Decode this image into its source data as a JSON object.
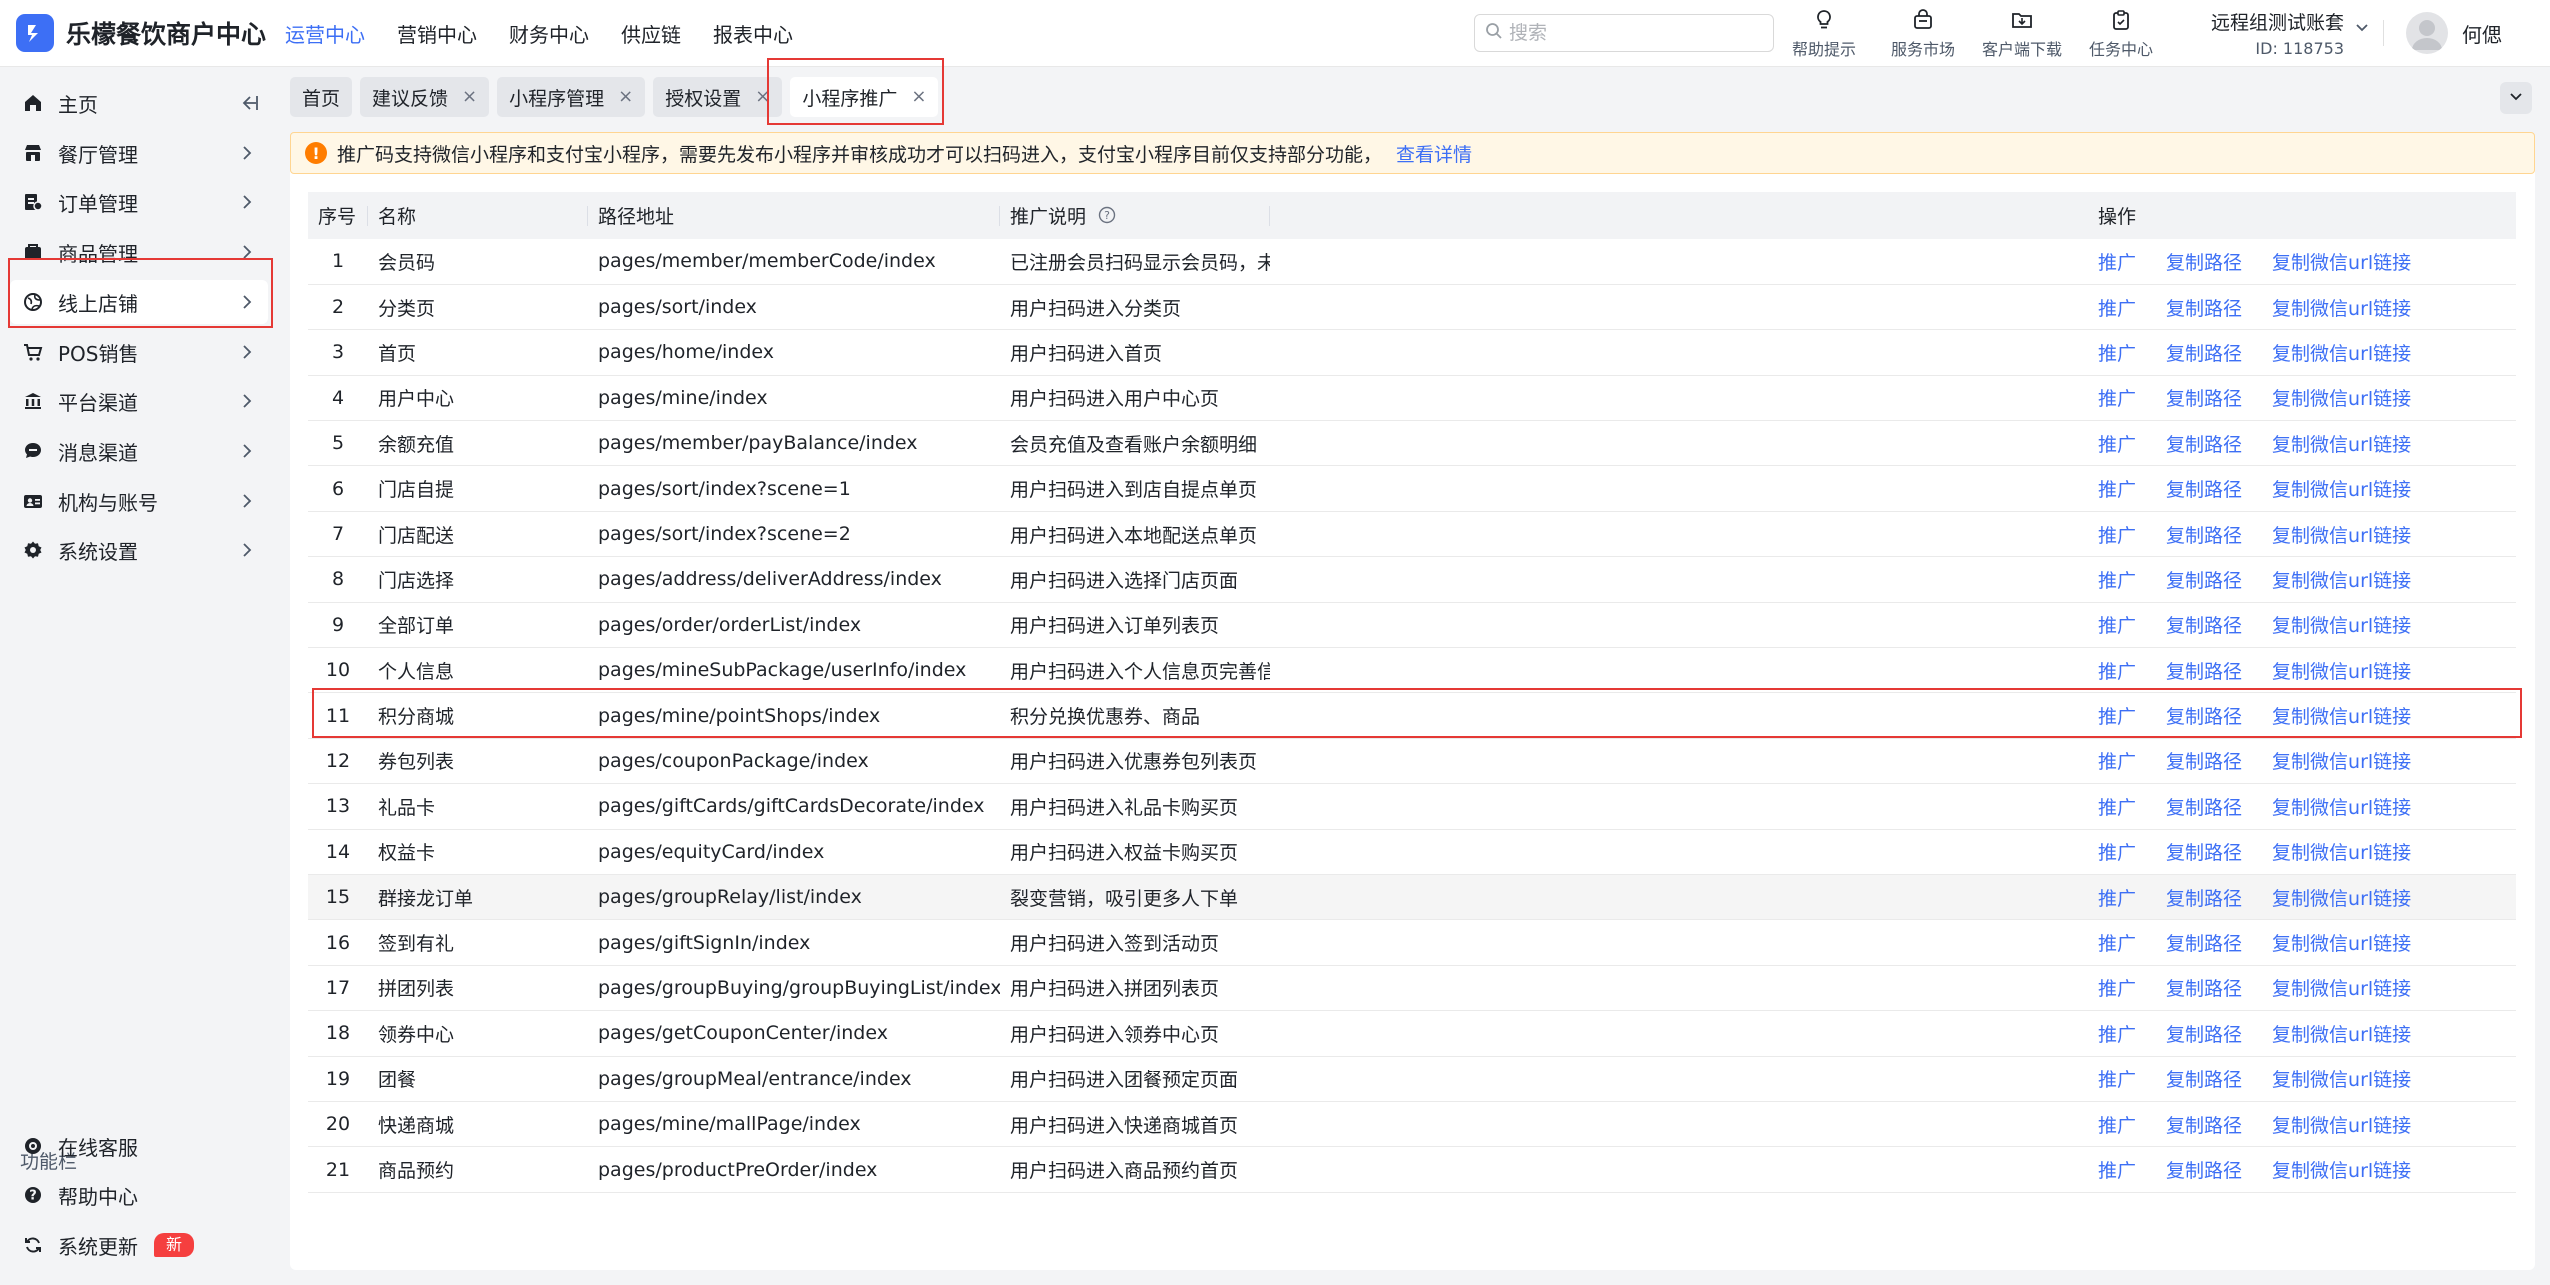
{
  "brand": {
    "name": "乐檬餐饮商户中心",
    "accent_color": "#3d6ff5"
  },
  "top_nav": [
    {
      "label": "运营中心",
      "active": true
    },
    {
      "label": "营销中心",
      "active": false
    },
    {
      "label": "财务中心",
      "active": false
    },
    {
      "label": "供应链",
      "active": false
    },
    {
      "label": "报表中心",
      "active": false
    }
  ],
  "search": {
    "placeholder": "搜索",
    "value": ""
  },
  "tools": [
    {
      "label": "帮助提示",
      "icon": "lightbulb-icon"
    },
    {
      "label": "服务市场",
      "icon": "shop-icon"
    },
    {
      "label": "客户端下载",
      "icon": "download-folder-icon"
    },
    {
      "label": "任务中心",
      "icon": "clipboard-icon"
    }
  ],
  "account": {
    "name": "远程组测试账套",
    "id": "ID: 118753"
  },
  "user": {
    "name": "何偲"
  },
  "sidebar": {
    "items": [
      {
        "label": "主页",
        "icon": "home-icon"
      },
      {
        "label": "餐厅管理",
        "icon": "restaurant-icon"
      },
      {
        "label": "订单管理",
        "icon": "order-icon"
      },
      {
        "label": "商品管理",
        "icon": "goods-icon"
      },
      {
        "label": "线上店铺",
        "icon": "online-store-icon",
        "active": true
      },
      {
        "label": "POS销售",
        "icon": "cart-icon"
      },
      {
        "label": "平台渠道",
        "icon": "bank-icon"
      },
      {
        "label": "消息渠道",
        "icon": "message-icon"
      },
      {
        "label": "机构与账号",
        "icon": "account-icon"
      },
      {
        "label": "系统设置",
        "icon": "gear-icon"
      }
    ],
    "section_title": "功能栏",
    "bottom_items": [
      {
        "label": "在线客服",
        "icon": "support-icon"
      },
      {
        "label": "帮助中心",
        "icon": "help-icon"
      },
      {
        "label": "系统更新",
        "icon": "refresh-icon",
        "badge": "新"
      }
    ]
  },
  "tabs": [
    {
      "label": "首页",
      "closable": false
    },
    {
      "label": "建议反馈",
      "closable": true
    },
    {
      "label": "小程序管理",
      "closable": true
    },
    {
      "label": "授权设置",
      "closable": true
    },
    {
      "label": "小程序推广",
      "closable": true,
      "active": true
    }
  ],
  "notice": {
    "text": "推广码支持微信小程序和支付宝小程序，需要先发布小程序并审核成功才可以扫码进入，支付宝小程序目前仅支持部分功能，",
    "link": "查看详情",
    "color": "#ff7d00"
  },
  "table": {
    "columns": [
      "序号",
      "名称",
      "路径地址",
      "推广说明",
      "操作"
    ],
    "actions": [
      "推广",
      "复制路径",
      "复制微信url链接"
    ],
    "rows": [
      {
        "no": "1",
        "name": "会员码",
        "path": "pages/member/memberCode/index",
        "desc": "已注册会员扫码显示会员码，未"
      },
      {
        "no": "2",
        "name": "分类页",
        "path": "pages/sort/index",
        "desc": "用户扫码进入分类页"
      },
      {
        "no": "3",
        "name": "首页",
        "path": "pages/home/index",
        "desc": "用户扫码进入首页"
      },
      {
        "no": "4",
        "name": "用户中心",
        "path": "pages/mine/index",
        "desc": "用户扫码进入用户中心页"
      },
      {
        "no": "5",
        "name": "余额充值",
        "path": "pages/member/payBalance/index",
        "desc": "会员充值及查看账户余额明细"
      },
      {
        "no": "6",
        "name": "门店自提",
        "path": "pages/sort/index?scene=1",
        "desc": "用户扫码进入到店自提点单页"
      },
      {
        "no": "7",
        "name": "门店配送",
        "path": "pages/sort/index?scene=2",
        "desc": "用户扫码进入本地配送点单页"
      },
      {
        "no": "8",
        "name": "门店选择",
        "path": "pages/address/deliverAddress/index",
        "desc": "用户扫码进入选择门店页面"
      },
      {
        "no": "9",
        "name": "全部订单",
        "path": "pages/order/orderList/index",
        "desc": "用户扫码进入订单列表页"
      },
      {
        "no": "10",
        "name": "个人信息",
        "path": "pages/mineSubPackage/userInfo/index",
        "desc": "用户扫码进入个人信息页完善信"
      },
      {
        "no": "11",
        "name": "积分商城",
        "path": "pages/mine/pointShops/index",
        "desc": "积分兑换优惠券、商品"
      },
      {
        "no": "12",
        "name": "券包列表",
        "path": "pages/couponPackage/index",
        "desc": "用户扫码进入优惠券包列表页"
      },
      {
        "no": "13",
        "name": "礼品卡",
        "path": "pages/giftCards/giftCardsDecorate/index",
        "desc": "用户扫码进入礼品卡购买页"
      },
      {
        "no": "14",
        "name": "权益卡",
        "path": "pages/equityCard/index",
        "desc": "用户扫码进入权益卡购买页"
      },
      {
        "no": "15",
        "name": "群接龙订单",
        "path": "pages/groupRelay/list/index",
        "desc": "裂变营销，吸引更多人下单"
      },
      {
        "no": "16",
        "name": "签到有礼",
        "path": "pages/giftSignIn/index",
        "desc": "用户扫码进入签到活动页"
      },
      {
        "no": "17",
        "name": "拼团列表",
        "path": "pages/groupBuying/groupBuyingList/index",
        "desc": "用户扫码进入拼团列表页"
      },
      {
        "no": "18",
        "name": "领券中心",
        "path": "pages/getCouponCenter/index",
        "desc": "用户扫码进入领券中心页"
      },
      {
        "no": "19",
        "name": "团餐",
        "path": "pages/groupMeal/entrance/index",
        "desc": "用户扫码进入团餐预定页面"
      },
      {
        "no": "20",
        "name": "快递商城",
        "path": "pages/mine/mallPage/index",
        "desc": "用户扫码进入快递商城首页"
      },
      {
        "no": "21",
        "name": "商品预约",
        "path": "pages/productPreOrder/index",
        "desc": "用户扫码进入商品预约首页"
      }
    ]
  },
  "colors": {
    "highlight_box": "#e53935",
    "link": "#3d6ff5",
    "hover_row": "#f5f5f5"
  }
}
